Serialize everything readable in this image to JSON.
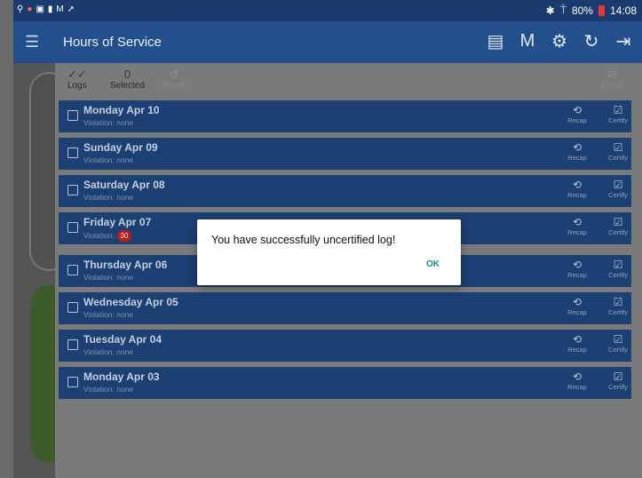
{
  "status_bar": {
    "left_icons": [
      "location-icon",
      "alert-icon",
      "image-icon",
      "doc-icon",
      "gmail-icon",
      "send-icon"
    ],
    "bluetooth": "✱",
    "signal": "⍑",
    "battery_percent": "80%",
    "time": "14:08"
  },
  "app_bar": {
    "title": "Hours of Service",
    "menu_icon": "☰",
    "actions": [
      {
        "name": "messages-icon",
        "glyph": "▤"
      },
      {
        "name": "m-icon",
        "glyph": "M"
      },
      {
        "name": "dvir-icon",
        "glyph": "⚙"
      },
      {
        "name": "refresh-icon",
        "glyph": "↻"
      },
      {
        "name": "logout-icon",
        "glyph": "⇥"
      }
    ]
  },
  "toolbar": {
    "logs_icon": "✓✓",
    "logs_label": "Logs",
    "selected_count": "0",
    "selected_label": "Selected",
    "reset_icon": "↺",
    "reset_label": "Reset",
    "email_icon": "✉",
    "email_label": "Email"
  },
  "logs": [
    {
      "day": "Monday Apr 10",
      "violation": "Violation: none",
      "badge": null
    },
    {
      "day": "Sunday Apr 09",
      "violation": "Violation: none",
      "badge": null
    },
    {
      "day": "Saturday Apr 08",
      "violation": "Violation: none",
      "badge": null
    },
    {
      "day": "Friday Apr 07",
      "violation": "Violation:",
      "badge": "30"
    },
    {
      "day": "Thursday Apr 06",
      "violation": "Violation: none",
      "badge": null
    },
    {
      "day": "Wednesday Apr 05",
      "violation": "Violation: none",
      "badge": null
    },
    {
      "day": "Tuesday Apr 04",
      "violation": "Violation: none",
      "badge": null
    },
    {
      "day": "Monday Apr 03",
      "violation": "Violation: none",
      "badge": null
    }
  ],
  "row_actions": {
    "recap_icon": "⟲",
    "recap_label": "Recap",
    "certify_icon": "☑",
    "certify_label": "Certify"
  },
  "dialog": {
    "message": "You have successfully uncertified log!",
    "ok_label": "OK"
  }
}
